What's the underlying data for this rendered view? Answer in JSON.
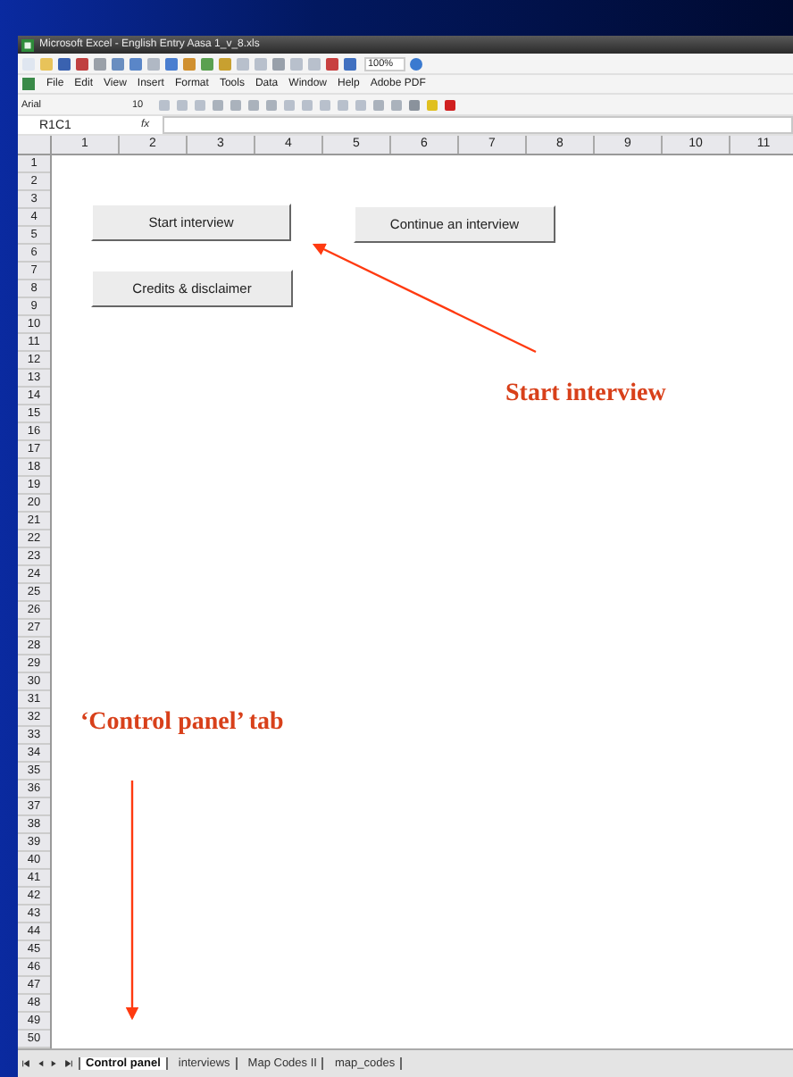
{
  "window": {
    "title": "Microsoft Excel - English Entry Aasa 1_v_8.xls"
  },
  "toolbar": {
    "zoom": "100%"
  },
  "menu": [
    "File",
    "Edit",
    "View",
    "Insert",
    "Format",
    "Tools",
    "Data",
    "Window",
    "Help",
    "Adobe PDF"
  ],
  "format_bar": {
    "font": "Arial",
    "size": "10"
  },
  "formula_bar": {
    "name_box": "R1C1",
    "function_label": "fx"
  },
  "columns": [
    "1",
    "2",
    "3",
    "4",
    "5",
    "6",
    "7",
    "8",
    "9",
    "10",
    "11"
  ],
  "rows": [
    "1",
    "2",
    "3",
    "4",
    "5",
    "6",
    "7",
    "8",
    "9",
    "10",
    "11",
    "12",
    "13",
    "14",
    "15",
    "16",
    "17",
    "18",
    "19",
    "20",
    "21",
    "22",
    "23",
    "24",
    "25",
    "26",
    "27",
    "28",
    "29",
    "30",
    "31",
    "32",
    "33",
    "34",
    "35",
    "36",
    "37",
    "38",
    "39",
    "40",
    "41",
    "42",
    "43",
    "44",
    "45",
    "46",
    "47",
    "48",
    "49",
    "50"
  ],
  "sheet_buttons": [
    "Start interview",
    "Continue an interview",
    "Credits & disclaimer"
  ],
  "sheet_tabs": [
    {
      "label": "Control panel",
      "selected": true
    },
    {
      "label": "interviews",
      "selected": false
    },
    {
      "label": "Map Codes II",
      "selected": false
    },
    {
      "label": "map_codes",
      "selected": false
    }
  ],
  "annotations": [
    "Start interview",
    "‘Control panel’ tab"
  ]
}
